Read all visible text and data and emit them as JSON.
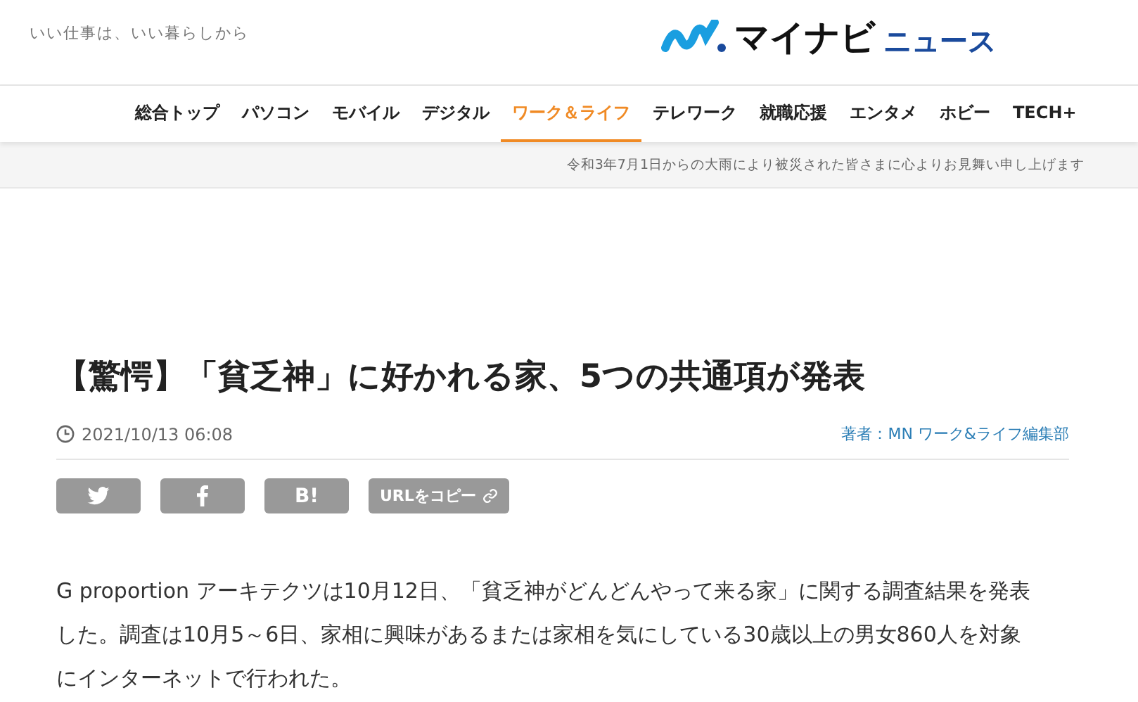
{
  "header": {
    "tagline": "いい仕事は、いい暮らしから",
    "logo": {
      "brand": "マイナビ",
      "suffix": "ニュース"
    }
  },
  "nav": [
    {
      "label": "総合トップ",
      "selected": false
    },
    {
      "label": "パソコン",
      "selected": false
    },
    {
      "label": "モバイル",
      "selected": false
    },
    {
      "label": "デジタル",
      "selected": false
    },
    {
      "label": "ワーク＆ライフ",
      "selected": true
    },
    {
      "label": "テレワーク",
      "selected": false
    },
    {
      "label": "就職応援",
      "selected": false
    },
    {
      "label": "エンタメ",
      "selected": false
    },
    {
      "label": "ホビー",
      "selected": false
    },
    {
      "label": "TECH+",
      "selected": false
    }
  ],
  "notice": "令和3年7月1日からの大雨により被災された皆さまに心よりお見舞い申し上げます",
  "article": {
    "title": "【驚愕】「貧乏神」に好かれる家、5つの共通項が発表",
    "date": "2021/10/13 06:08",
    "author": "著者：MN ワーク&ライフ編集部",
    "share": [
      {
        "kind": "twitter"
      },
      {
        "kind": "facebook"
      },
      {
        "kind": "hatena",
        "label": "B!"
      },
      {
        "kind": "copy",
        "label": "URLをコピー"
      }
    ],
    "body": "G proportion アーキテクツは10月12日、「貧乏神がどんどんやって来る家」に関する調査結果を発表した。調査は10月5～6日、家相に興味があるまたは家相を気にしている30歳以上の男女860人を対象にインターネットで行われた。"
  }
}
